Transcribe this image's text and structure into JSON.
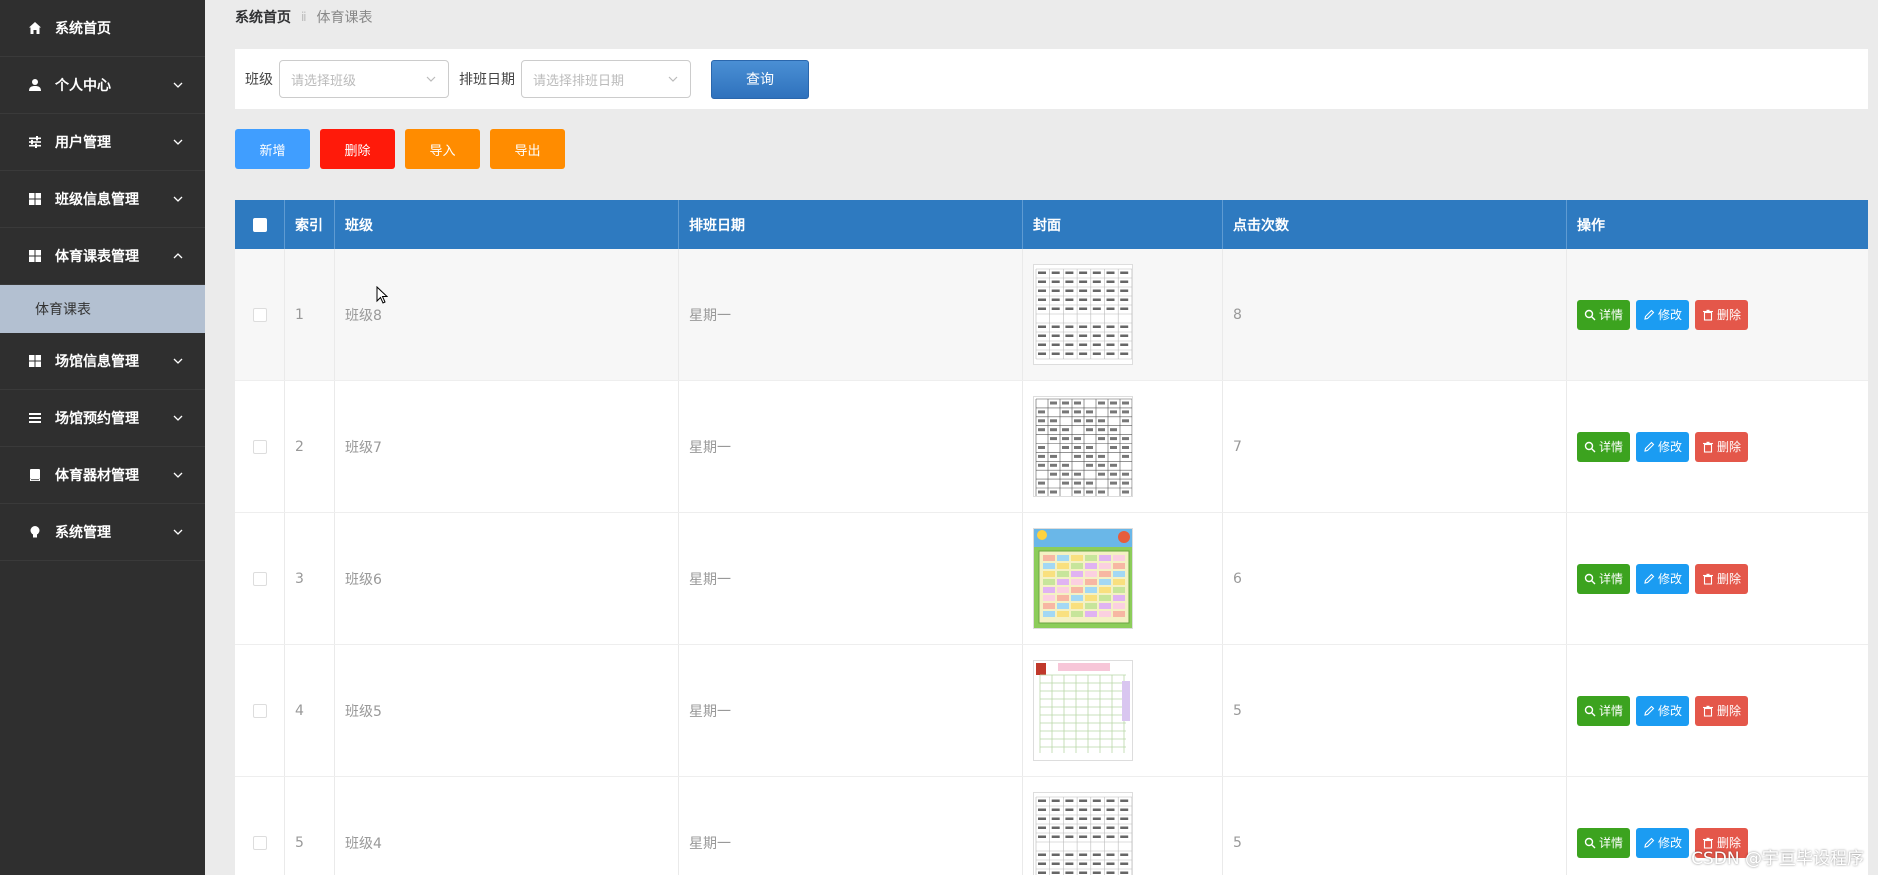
{
  "sidebar": {
    "items": [
      {
        "label": "系统首页",
        "icon": "home-icon",
        "expandable": false
      },
      {
        "label": "个人中心",
        "icon": "user-icon",
        "expandable": true
      },
      {
        "label": "用户管理",
        "icon": "sliders-icon",
        "expandable": true
      },
      {
        "label": "班级信息管理",
        "icon": "grid-icon",
        "expandable": true
      },
      {
        "label": "体育课表管理",
        "icon": "grid-icon",
        "expandable": true,
        "expanded": true,
        "children": [
          {
            "label": "体育课表"
          }
        ]
      },
      {
        "label": "场馆信息管理",
        "icon": "grid-icon",
        "expandable": true
      },
      {
        "label": "场馆预约管理",
        "icon": "list-icon",
        "expandable": true
      },
      {
        "label": "体育器材管理",
        "icon": "book-icon",
        "expandable": true
      },
      {
        "label": "系统管理",
        "icon": "bulb-icon",
        "expandable": true
      }
    ]
  },
  "breadcrumb": {
    "home": "系统首页",
    "separator": "ⅱ",
    "current": "体育课表"
  },
  "search": {
    "class_label": "班级",
    "class_placeholder": "请选择班级",
    "date_label": "排班日期",
    "date_placeholder": "请选择排班日期",
    "query_label": "查询"
  },
  "toolbar": {
    "add_label": "新增",
    "delete_label": "删除",
    "import_label": "导入",
    "export_label": "导出",
    "colors": {
      "add": "#409eff",
      "delete": "#ff1a0a",
      "import": "#ff8c00",
      "export": "#ff8c00"
    }
  },
  "table": {
    "headers": {
      "index": "索引",
      "class": "班级",
      "date": "排班日期",
      "cover": "封面",
      "clicks": "点击次数",
      "ops": "操作"
    },
    "rows": [
      {
        "index": "1",
        "class": "班级8",
        "date": "星期一",
        "clicks": "8",
        "cover_style": "table-white"
      },
      {
        "index": "2",
        "class": "班级7",
        "date": "星期一",
        "clicks": "7",
        "cover_style": "table-grid"
      },
      {
        "index": "3",
        "class": "班级6",
        "date": "星期一",
        "clicks": "6",
        "cover_style": "colorful"
      },
      {
        "index": "4",
        "class": "班级5",
        "date": "星期一",
        "clicks": "5",
        "cover_style": "pink-table"
      },
      {
        "index": "5",
        "class": "班级4",
        "date": "星期一",
        "clicks": "5",
        "cover_style": "table-white"
      }
    ],
    "ops": {
      "detail": "详情",
      "edit": "修改",
      "delete": "删除"
    }
  },
  "watermark": "CSDN @宇亘毕设程序",
  "colors": {
    "sidebar_bg": "#2f2f2f",
    "header_blue": "#2e7ac0",
    "op_detail": "#3ca31f",
    "op_edit": "#1b9cf2",
    "op_delete": "#e4574a"
  }
}
